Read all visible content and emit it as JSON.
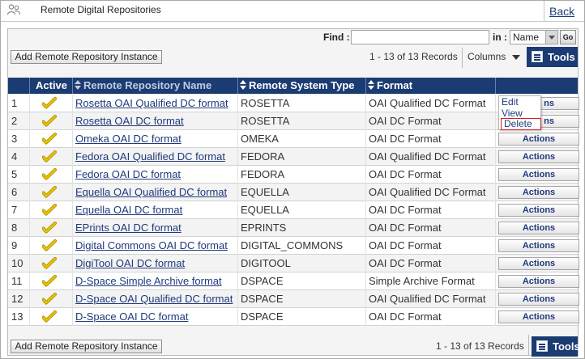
{
  "header": {
    "title": "Remote Digital Repositories",
    "icon": "users-icon",
    "back_label": "Back"
  },
  "toolbar": {
    "find_label": "Find :",
    "find_value": "",
    "in_label": "in :",
    "in_selected": "Name",
    "go_label": "Go",
    "add_label": "Add Remote Repository Instance",
    "records_label": "1 - 13 of 13 Records",
    "columns_label": "Columns",
    "tools_label": "Tools"
  },
  "table": {
    "headers": {
      "active": "Active",
      "name": "Remote Repository Name",
      "system": "Remote System Type",
      "format": "Format"
    },
    "action_label": "Actions",
    "rows": [
      {
        "num": "1",
        "name": "Rosetta OAI Qualified DC format",
        "system": "ROSETTA",
        "format": "OAI Qualified DC Format",
        "action": "ns"
      },
      {
        "num": "2",
        "name": "Rosetta OAI DC format",
        "system": "ROSETTA",
        "format": "OAI DC Format",
        "action": "ns"
      },
      {
        "num": "3",
        "name": "Omeka OAI DC format",
        "system": "OMEKA",
        "format": "OAI DC Format",
        "action": "Actions"
      },
      {
        "num": "4",
        "name": "Fedora OAI Qualified DC format",
        "system": "FEDORA",
        "format": "OAI Qualified DC Format",
        "action": "Actions"
      },
      {
        "num": "5",
        "name": "Fedora OAI DC format",
        "system": "FEDORA",
        "format": "OAI DC Format",
        "action": "Actions"
      },
      {
        "num": "6",
        "name": "Equella OAI Qualified DC format",
        "system": "EQUELLA",
        "format": "OAI Qualified DC Format",
        "action": "Actions"
      },
      {
        "num": "7",
        "name": "Equella OAI DC format",
        "system": "EQUELLA",
        "format": "OAI DC Format",
        "action": "Actions"
      },
      {
        "num": "8",
        "name": "EPrints OAI DC format",
        "system": "EPRINTS",
        "format": "OAI DC Format",
        "action": "Actions"
      },
      {
        "num": "9",
        "name": "Digital Commons OAI DC format",
        "system": "DIGITAL_COMMONS",
        "format": "OAI DC Format",
        "action": "Actions"
      },
      {
        "num": "10",
        "name": "DigiTool OAI DC format",
        "system": "DIGITOOL",
        "format": "OAI DC Format",
        "action": "Actions"
      },
      {
        "num": "11",
        "name": "D-Space Simple Archive format",
        "system": "DSPACE",
        "format": "Simple Archive Format",
        "action": "Actions"
      },
      {
        "num": "12",
        "name": "D-Space OAI Qualified DC format",
        "system": "DSPACE",
        "format": "OAI Qualified DC Format",
        "action": "Actions"
      },
      {
        "num": "13",
        "name": "D-Space OAI DC format",
        "system": "DSPACE",
        "format": "OAI DC Format",
        "action": "Actions"
      }
    ]
  },
  "row_menu": {
    "edit": "Edit",
    "view": "View",
    "delete": "Delete"
  },
  "colors": {
    "header_bg": "#1b3c73",
    "link": "#1f3a7a",
    "delete_outline": "#d21f1f",
    "check": "#e6c400"
  }
}
